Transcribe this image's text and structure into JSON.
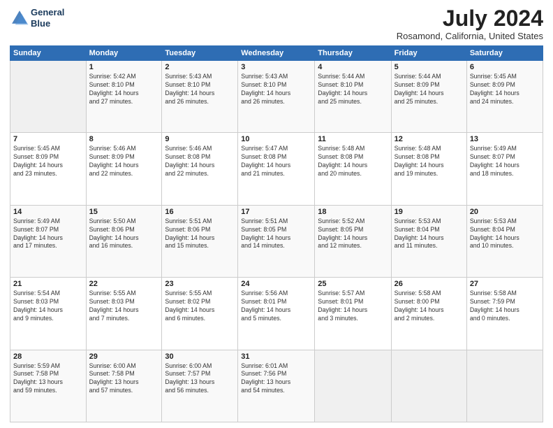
{
  "header": {
    "logo_line1": "General",
    "logo_line2": "Blue",
    "month_year": "July 2024",
    "location": "Rosamond, California, United States"
  },
  "weekdays": [
    "Sunday",
    "Monday",
    "Tuesday",
    "Wednesday",
    "Thursday",
    "Friday",
    "Saturday"
  ],
  "weeks": [
    [
      {
        "day": "",
        "info": ""
      },
      {
        "day": "1",
        "info": "Sunrise: 5:42 AM\nSunset: 8:10 PM\nDaylight: 14 hours\nand 27 minutes."
      },
      {
        "day": "2",
        "info": "Sunrise: 5:43 AM\nSunset: 8:10 PM\nDaylight: 14 hours\nand 26 minutes."
      },
      {
        "day": "3",
        "info": "Sunrise: 5:43 AM\nSunset: 8:10 PM\nDaylight: 14 hours\nand 26 minutes."
      },
      {
        "day": "4",
        "info": "Sunrise: 5:44 AM\nSunset: 8:10 PM\nDaylight: 14 hours\nand 25 minutes."
      },
      {
        "day": "5",
        "info": "Sunrise: 5:44 AM\nSunset: 8:09 PM\nDaylight: 14 hours\nand 25 minutes."
      },
      {
        "day": "6",
        "info": "Sunrise: 5:45 AM\nSunset: 8:09 PM\nDaylight: 14 hours\nand 24 minutes."
      }
    ],
    [
      {
        "day": "7",
        "info": "Sunrise: 5:45 AM\nSunset: 8:09 PM\nDaylight: 14 hours\nand 23 minutes."
      },
      {
        "day": "8",
        "info": "Sunrise: 5:46 AM\nSunset: 8:09 PM\nDaylight: 14 hours\nand 22 minutes."
      },
      {
        "day": "9",
        "info": "Sunrise: 5:46 AM\nSunset: 8:08 PM\nDaylight: 14 hours\nand 22 minutes."
      },
      {
        "day": "10",
        "info": "Sunrise: 5:47 AM\nSunset: 8:08 PM\nDaylight: 14 hours\nand 21 minutes."
      },
      {
        "day": "11",
        "info": "Sunrise: 5:48 AM\nSunset: 8:08 PM\nDaylight: 14 hours\nand 20 minutes."
      },
      {
        "day": "12",
        "info": "Sunrise: 5:48 AM\nSunset: 8:08 PM\nDaylight: 14 hours\nand 19 minutes."
      },
      {
        "day": "13",
        "info": "Sunrise: 5:49 AM\nSunset: 8:07 PM\nDaylight: 14 hours\nand 18 minutes."
      }
    ],
    [
      {
        "day": "14",
        "info": "Sunrise: 5:49 AM\nSunset: 8:07 PM\nDaylight: 14 hours\nand 17 minutes."
      },
      {
        "day": "15",
        "info": "Sunrise: 5:50 AM\nSunset: 8:06 PM\nDaylight: 14 hours\nand 16 minutes."
      },
      {
        "day": "16",
        "info": "Sunrise: 5:51 AM\nSunset: 8:06 PM\nDaylight: 14 hours\nand 15 minutes."
      },
      {
        "day": "17",
        "info": "Sunrise: 5:51 AM\nSunset: 8:05 PM\nDaylight: 14 hours\nand 14 minutes."
      },
      {
        "day": "18",
        "info": "Sunrise: 5:52 AM\nSunset: 8:05 PM\nDaylight: 14 hours\nand 12 minutes."
      },
      {
        "day": "19",
        "info": "Sunrise: 5:53 AM\nSunset: 8:04 PM\nDaylight: 14 hours\nand 11 minutes."
      },
      {
        "day": "20",
        "info": "Sunrise: 5:53 AM\nSunset: 8:04 PM\nDaylight: 14 hours\nand 10 minutes."
      }
    ],
    [
      {
        "day": "21",
        "info": "Sunrise: 5:54 AM\nSunset: 8:03 PM\nDaylight: 14 hours\nand 9 minutes."
      },
      {
        "day": "22",
        "info": "Sunrise: 5:55 AM\nSunset: 8:03 PM\nDaylight: 14 hours\nand 7 minutes."
      },
      {
        "day": "23",
        "info": "Sunrise: 5:55 AM\nSunset: 8:02 PM\nDaylight: 14 hours\nand 6 minutes."
      },
      {
        "day": "24",
        "info": "Sunrise: 5:56 AM\nSunset: 8:01 PM\nDaylight: 14 hours\nand 5 minutes."
      },
      {
        "day": "25",
        "info": "Sunrise: 5:57 AM\nSunset: 8:01 PM\nDaylight: 14 hours\nand 3 minutes."
      },
      {
        "day": "26",
        "info": "Sunrise: 5:58 AM\nSunset: 8:00 PM\nDaylight: 14 hours\nand 2 minutes."
      },
      {
        "day": "27",
        "info": "Sunrise: 5:58 AM\nSunset: 7:59 PM\nDaylight: 14 hours\nand 0 minutes."
      }
    ],
    [
      {
        "day": "28",
        "info": "Sunrise: 5:59 AM\nSunset: 7:58 PM\nDaylight: 13 hours\nand 59 minutes."
      },
      {
        "day": "29",
        "info": "Sunrise: 6:00 AM\nSunset: 7:58 PM\nDaylight: 13 hours\nand 57 minutes."
      },
      {
        "day": "30",
        "info": "Sunrise: 6:00 AM\nSunset: 7:57 PM\nDaylight: 13 hours\nand 56 minutes."
      },
      {
        "day": "31",
        "info": "Sunrise: 6:01 AM\nSunset: 7:56 PM\nDaylight: 13 hours\nand 54 minutes."
      },
      {
        "day": "",
        "info": ""
      },
      {
        "day": "",
        "info": ""
      },
      {
        "day": "",
        "info": ""
      }
    ]
  ]
}
